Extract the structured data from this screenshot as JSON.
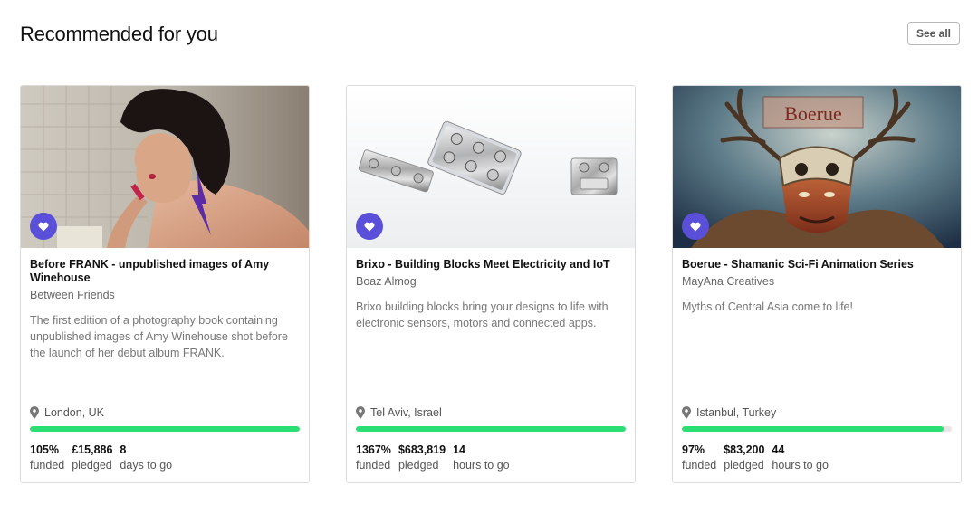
{
  "header": {
    "title": "Recommended for you",
    "see_all": "See all"
  },
  "colors": {
    "accent": "#5a4fd8",
    "progress": "#2bde73",
    "track": "#e6e6e6"
  },
  "cards": [
    {
      "title": "Before FRANK - unpublished images of Amy Winehouse",
      "creator": "Between Friends",
      "description": "The first edition of a photography book containing unpublished images of Amy Winehouse shot before the launch of her debut album FRANK.",
      "location": "London, UK",
      "progress_fraction": 1.0,
      "funded": "105%",
      "funded_label": "funded",
      "pledged": "£15,886",
      "pledged_label": "pledged",
      "days": "8",
      "days_label": "days to go",
      "image": "photo-woman-applying-lipstick"
    },
    {
      "title": "Brixo - Building Blocks Meet Electricity and IoT",
      "creator": "Boaz Almog",
      "description": "Brixo building blocks bring your designs to life with electronic sensors, motors and connected apps.",
      "location": "Tel Aviv, Israel",
      "progress_fraction": 1.0,
      "funded": "1367%",
      "funded_label": "funded",
      "pledged": "$683,819",
      "pledged_label": "pledged",
      "days": "14",
      "days_label": "hours to go",
      "image": "photo-chrome-building-blocks"
    },
    {
      "title": "Boerue - Shamanic Sci-Fi Animation Series",
      "creator": "MayAna Creatives",
      "description": "Myths of Central Asia come to life!",
      "location": "Istanbul, Turkey",
      "progress_fraction": 0.97,
      "funded": "97%",
      "funded_label": "funded",
      "pledged": "$83,200",
      "pledged_label": "pledged",
      "days": "44",
      "days_label": "hours to go",
      "image": "illustration-shaman-with-antlers",
      "image_text": "Boerue"
    }
  ]
}
